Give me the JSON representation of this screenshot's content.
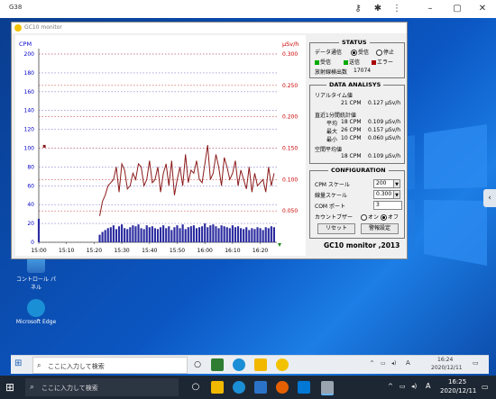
{
  "outer_window": {
    "title": "G38"
  },
  "app": {
    "title": "GC10 monitor",
    "footer": "GC10 monitor ,2013",
    "status": {
      "title": "STATUS",
      "comm_label": "データ通信",
      "radio_receive": "受信",
      "radio_stop": "停止",
      "indicator_receive": "受信",
      "indicator_send": "送信",
      "indicator_error": "エラー",
      "count_label": "放射線検出数",
      "count_value": "17074"
    },
    "analysis": {
      "title": "DATA ANALISYS",
      "realtime_label": "リアルタイム値",
      "realtime_cpm": "21 CPM",
      "realtime_usv": "0.127 µSv/h",
      "interval_label": "直近1分間統計値",
      "avg_label": "平均",
      "avg_cpm": "18 CPM",
      "avg_usv": "0.109 µSv/h",
      "max_label": "最大",
      "max_cpm": "26 CPM",
      "max_usv": "0.157 µSv/h",
      "min_label": "最小",
      "min_cpm": "10 CPM",
      "min_usv": "0.060 µSv/h",
      "spatial_label": "空間平均値",
      "spatial_cpm": "18 CPM",
      "spatial_usv": "0.109 µSv/h"
    },
    "config": {
      "title": "CONFIGURATION",
      "cpm_scale_label": "CPM スケール",
      "cpm_scale_value": "200",
      "dose_scale_label": "線量スケール",
      "dose_scale_value": "0.300",
      "com_port_label": "COM ポート",
      "com_port_value": "3",
      "buzzer_label": "カウントブザー",
      "buzzer_on": "オン",
      "buzzer_off": "オフ",
      "reset_button": "リセット",
      "alarm_button": "警報設定"
    }
  },
  "desktop": {
    "icon_control_panel": "コントロール パネル",
    "icon_edge": "Microsoft Edge"
  },
  "inner_taskbar": {
    "search_placeholder": "ここに入力して検索",
    "time": "16:24",
    "date": "2020/12/11",
    "ime": "A"
  },
  "bottom_taskbar": {
    "search_placeholder": "ここに入力して検索",
    "time": "16:25",
    "date": "2020/12/11",
    "ime": "A"
  },
  "colors": {
    "cpm_axis": "#0000cc",
    "dose_axis": "#cc0000",
    "line": "#8b1a1a",
    "bars": "#2b2ba0",
    "desktop_blue": "#0b56c2"
  },
  "chart_data": {
    "type": "line",
    "left_axis": {
      "label": "CPM",
      "ticks": [
        0,
        20,
        40,
        60,
        80,
        100,
        120,
        140,
        160,
        180,
        200
      ],
      "ylim": [
        0,
        200
      ]
    },
    "right_axis": {
      "label": "µSv/h",
      "ticks": [
        "0.050",
        "0.100",
        "0.150",
        "0.200",
        "0.250",
        "0.300"
      ],
      "ylim": [
        0,
        0.3
      ]
    },
    "x_ticks": [
      "15:00",
      "15:10",
      "15:20",
      "15:30",
      "15:40",
      "15:50",
      "16:00",
      "16:10",
      "16:20"
    ],
    "x_range_minutes": [
      0,
      86
    ],
    "grid": true,
    "series": [
      {
        "type": "line",
        "x": [
          22,
          23,
          24,
          25,
          26,
          27,
          28,
          29,
          30,
          31,
          32,
          33,
          34,
          35,
          36,
          37,
          38,
          39,
          40,
          41,
          42,
          43,
          44,
          45,
          46,
          47,
          48,
          49,
          50,
          51,
          52,
          53,
          54,
          55,
          56,
          57,
          58,
          59,
          60,
          61,
          62,
          63,
          64,
          65,
          66,
          67,
          68,
          69,
          70,
          71,
          72,
          73,
          74,
          75,
          76,
          77,
          78,
          79,
          80,
          81,
          82,
          83,
          84,
          85
        ],
        "values": [
          0.042,
          0.065,
          0.075,
          0.09,
          0.095,
          0.1,
          0.12,
          0.08,
          0.125,
          0.115,
          0.085,
          0.09,
          0.11,
          0.1,
          0.125,
          0.12,
          0.09,
          0.1,
          0.13,
          0.095,
          0.1,
          0.12,
          0.08,
          0.11,
          0.125,
          0.09,
          0.13,
          0.075,
          0.1,
          0.12,
          0.09,
          0.14,
          0.095,
          0.115,
          0.11,
          0.13,
          0.1,
          0.095,
          0.125,
          0.155,
          0.1,
          0.11,
          0.14,
          0.12,
          0.09,
          0.135,
          0.12,
          0.1,
          0.11,
          0.13,
          0.09,
          0.115,
          0.1,
          0.085,
          0.12,
          0.08,
          0.11,
          0.09,
          0.095,
          0.1,
          0.08,
          0.12,
          0.09,
          0.11
        ]
      },
      {
        "type": "bar",
        "x": [
          0,
          22,
          23,
          24,
          25,
          26,
          27,
          28,
          29,
          30,
          31,
          32,
          33,
          34,
          35,
          36,
          37,
          38,
          39,
          40,
          41,
          42,
          43,
          44,
          45,
          46,
          47,
          48,
          49,
          50,
          51,
          52,
          53,
          54,
          55,
          56,
          57,
          58,
          59,
          60,
          61,
          62,
          63,
          64,
          65,
          66,
          67,
          68,
          69,
          70,
          71,
          72,
          73,
          74,
          75,
          76,
          77,
          78,
          79,
          80,
          81,
          82,
          83,
          84,
          85
        ],
        "values": [
          25,
          8,
          11,
          13,
          15,
          16,
          18,
          14,
          17,
          19,
          15,
          14,
          16,
          18,
          17,
          19,
          15,
          14,
          18,
          16,
          17,
          15,
          14,
          16,
          18,
          15,
          17,
          13,
          16,
          18,
          15,
          19,
          14,
          16,
          17,
          18,
          15,
          16,
          17,
          20,
          16,
          18,
          19,
          17,
          15,
          18,
          17,
          16,
          15,
          18,
          16,
          17,
          15,
          14,
          16,
          13,
          15,
          14,
          16,
          15,
          13,
          16,
          15,
          17,
          16
        ]
      }
    ],
    "marker": {
      "x": 2,
      "value": 0.153
    }
  }
}
